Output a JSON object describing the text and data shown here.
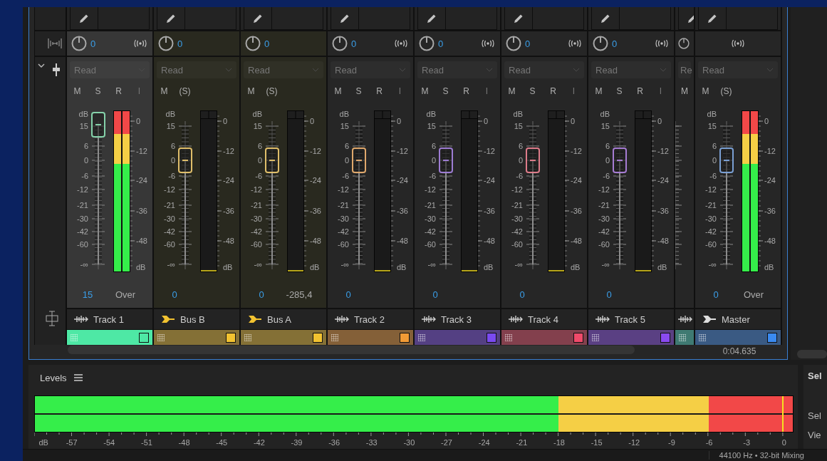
{
  "mixer": {
    "strips": [
      {
        "kind": "track",
        "name": "Track 1",
        "selected": true,
        "color": "#4ee8a5",
        "pan": "0",
        "output_icon": true,
        "automation": {
          "value": "Read",
          "disabled": true
        },
        "buttons": [
          {
            "label": "M",
            "disabled": false
          },
          {
            "label": "S",
            "disabled": false
          },
          {
            "label": "R",
            "disabled": false
          },
          {
            "label": "I",
            "disabled": true
          }
        ],
        "fader": {
          "level": 1
        },
        "fader_scale": [
          "dB",
          "15",
          "6",
          "0",
          "-6",
          "-12",
          "-21",
          "-30",
          "-42",
          "-60",
          "-∞"
        ],
        "meter": {
          "level": 1,
          "clip": true
        },
        "meter_scale": [
          "0",
          "-12",
          "-24",
          "-36",
          "-48",
          "dB"
        ],
        "volume": "15",
        "peak": "Over"
      },
      {
        "kind": "bus",
        "name": "Bus B",
        "selected": false,
        "color": "#f2c230",
        "pan": "0",
        "output_icon": false,
        "automation": {
          "value": "Read",
          "disabled": true
        },
        "buttons": [
          {
            "label": "M",
            "disabled": false
          },
          {
            "label": "(S)",
            "disabled": false
          }
        ],
        "fader": {
          "level": 0.745
        },
        "fader_scale": [
          "dB",
          "15",
          "6",
          "0",
          "-6",
          "-12",
          "-21",
          "-30",
          "-42",
          "-60",
          "-∞"
        ],
        "meter": {
          "level": 0,
          "clip": false
        },
        "meter_scale": [
          "0",
          "-12",
          "-24",
          "-36",
          "-48",
          "dB"
        ],
        "volume": "0"
      },
      {
        "kind": "bus",
        "name": "Bus A",
        "selected": false,
        "color": "#f2c230",
        "pan": "0",
        "output_icon": false,
        "automation": {
          "value": "Read",
          "disabled": true
        },
        "buttons": [
          {
            "label": "M",
            "disabled": false
          },
          {
            "label": "(S)",
            "disabled": false
          }
        ],
        "fader": {
          "level": 0.745
        },
        "fader_scale": [
          "dB",
          "15",
          "6",
          "0",
          "-6",
          "-12",
          "-21",
          "-30",
          "-42",
          "-60",
          "-∞"
        ],
        "meter": {
          "level": 0,
          "clip": false
        },
        "meter_scale": [
          "0",
          "-12",
          "-24",
          "-36",
          "-48",
          "dB"
        ],
        "volume": "0",
        "peak": "-285,4"
      },
      {
        "kind": "track",
        "name": "Track 2",
        "selected": false,
        "color": "#f29a35",
        "pan": "0",
        "output_icon": true,
        "automation": {
          "value": "Read",
          "disabled": true
        },
        "buttons": [
          {
            "label": "M",
            "disabled": false
          },
          {
            "label": "S",
            "disabled": false
          },
          {
            "label": "R",
            "disabled": false
          },
          {
            "label": "I",
            "disabled": true
          }
        ],
        "fader": {
          "level": 0.745
        },
        "fader_scale": [
          "dB",
          "15",
          "6",
          "0",
          "-6",
          "-12",
          "-21",
          "-30",
          "-42",
          "-60",
          "-∞"
        ],
        "meter": {
          "level": 0,
          "clip": false
        },
        "meter_scale": [
          "0",
          "-12",
          "-24",
          "-36",
          "-48",
          "dB"
        ],
        "volume": "0"
      },
      {
        "kind": "track",
        "name": "Track 3",
        "selected": false,
        "color": "#7a4af0",
        "pan": "0",
        "output_icon": true,
        "automation": {
          "value": "Read",
          "disabled": true
        },
        "buttons": [
          {
            "label": "M",
            "disabled": false
          },
          {
            "label": "S",
            "disabled": false
          },
          {
            "label": "R",
            "disabled": false
          },
          {
            "label": "I",
            "disabled": true
          }
        ],
        "fader": {
          "level": 0.745
        },
        "fader_scale": [
          "dB",
          "15",
          "6",
          "0",
          "-6",
          "-12",
          "-21",
          "-30",
          "-42",
          "-60",
          "-∞"
        ],
        "meter": {
          "level": 0,
          "clip": false
        },
        "meter_scale": [
          "0",
          "-12",
          "-24",
          "-36",
          "-48",
          "dB"
        ],
        "volume": "0"
      },
      {
        "kind": "track",
        "name": "Track 4",
        "selected": false,
        "color": "#f04a6a",
        "pan": "0",
        "output_icon": true,
        "automation": {
          "value": "Read",
          "disabled": true
        },
        "buttons": [
          {
            "label": "M",
            "disabled": false
          },
          {
            "label": "S",
            "disabled": false
          },
          {
            "label": "R",
            "disabled": false
          },
          {
            "label": "I",
            "disabled": true
          }
        ],
        "fader": {
          "level": 0.745
        },
        "fader_scale": [
          "dB",
          "15",
          "6",
          "0",
          "-6",
          "-12",
          "-21",
          "-30",
          "-42",
          "-60",
          "-∞"
        ],
        "meter": {
          "level": 0,
          "clip": false
        },
        "meter_scale": [
          "0",
          "-12",
          "-24",
          "-36",
          "-48",
          "dB"
        ],
        "volume": "0"
      },
      {
        "kind": "track",
        "name": "Track 5",
        "selected": false,
        "color": "#8a4af0",
        "pan": "0",
        "output_icon": true,
        "automation": {
          "value": "Read",
          "disabled": true
        },
        "buttons": [
          {
            "label": "M",
            "disabled": false
          },
          {
            "label": "S",
            "disabled": false
          },
          {
            "label": "R",
            "disabled": false
          },
          {
            "label": "I",
            "disabled": true
          }
        ],
        "fader": {
          "level": 0.745
        },
        "fader_scale": [
          "dB",
          "15",
          "6",
          "0",
          "-6",
          "-12",
          "-21",
          "-30",
          "-42",
          "-60",
          "-∞"
        ],
        "meter": {
          "level": 0,
          "clip": false
        },
        "meter_scale": [
          "0",
          "-12",
          "-24",
          "-36",
          "-48",
          "dB"
        ],
        "volume": "0"
      },
      {
        "kind": "track",
        "partial": true,
        "selected": false,
        "color": "#3f7a72",
        "automation": {
          "value": "Re",
          "disabled": true
        },
        "buttons": [
          {
            "label": "M",
            "disabled": false
          }
        ]
      },
      {
        "kind": "master",
        "name": "Master",
        "selected": false,
        "color": "#3a8af0",
        "output_icon": true,
        "automation": {
          "value": "Read",
          "disabled": true
        },
        "buttons": [
          {
            "label": "M",
            "disabled": false
          },
          {
            "label": "(S)",
            "disabled": false
          }
        ],
        "fader": {
          "level": 0.745
        },
        "fader_scale": [
          "dB",
          "15",
          "6",
          "0",
          "-6",
          "-12",
          "-21",
          "-30",
          "-42",
          "-60",
          "-∞"
        ],
        "meter": {
          "level": 1,
          "clip": true
        },
        "meter_scale": [
          "0",
          "-12",
          "-24",
          "-36",
          "-48",
          "dB"
        ],
        "volume": "0",
        "peak": "Over"
      }
    ],
    "time": "0:04.635"
  },
  "levels": {
    "title": "Levels",
    "level": 1,
    "scale": [
      "dB",
      "-57",
      "-54",
      "-51",
      "-48",
      "-45",
      "-42",
      "-39",
      "-36",
      "-33",
      "-30",
      "-27",
      "-24",
      "-21",
      "-18",
      "-15",
      "-12",
      "-9",
      "-6",
      "-3",
      "0"
    ]
  },
  "side_panel": {
    "items": [
      {
        "kind": "heading",
        "text": "Sel"
      },
      {
        "kind": "label",
        "text": "Sel"
      },
      {
        "kind": "label",
        "text": "Vie"
      }
    ]
  },
  "status_bar": {
    "text": "44100 Hz • 32-bit Mixing"
  }
}
